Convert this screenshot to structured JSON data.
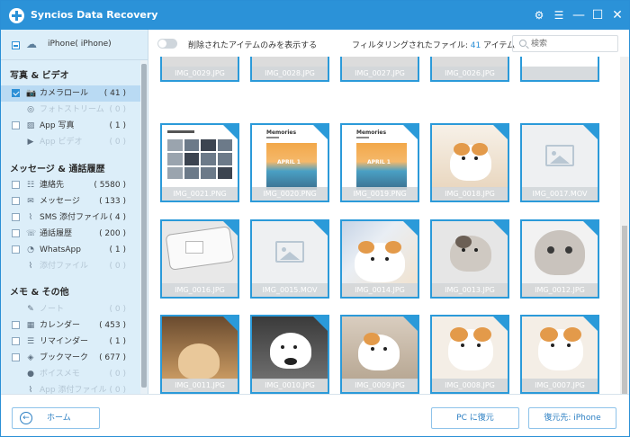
{
  "app": {
    "title": "Syncios Data Recovery"
  },
  "device": {
    "name": "iPhone( iPhone)"
  },
  "sidebar": {
    "photo_section": "写真 & ビデオ",
    "photo_items": [
      {
        "label": "カメラロール",
        "count": "( 41 )"
      },
      {
        "label": "フォトストリーム",
        "count": "( 0 )"
      },
      {
        "label": "App 写真",
        "count": "( 1 )"
      },
      {
        "label": "App ビデオ",
        "count": "( 0 )"
      }
    ],
    "message_section": "メッセージ & 通話履歴",
    "message_items": [
      {
        "label": "連絡先",
        "count": "( 5580 )"
      },
      {
        "label": "メッセージ",
        "count": "( 133 )"
      },
      {
        "label": "SMS 添付ファイル",
        "count": "( 4 )"
      },
      {
        "label": "通話履歴",
        "count": "( 200 )"
      },
      {
        "label": "WhatsApp",
        "count": "( 1 )"
      },
      {
        "label": "添付ファイル",
        "count": "( 0 )"
      }
    ],
    "memo_section": "メモ & その他",
    "memo_items": [
      {
        "label": "ノート",
        "count": "( 0 )"
      },
      {
        "label": "カレンダー",
        "count": "( 453 )"
      },
      {
        "label": "リマインダー",
        "count": "( 1 )"
      },
      {
        "label": "ブックマーク",
        "count": "( 677 )"
      },
      {
        "label": "ボイスメモ",
        "count": "( 0 )"
      },
      {
        "label": "App 添付ファイル",
        "count": "( 0 )"
      }
    ]
  },
  "toolbar": {
    "toggle_label": "削除されたアイテムのみを表示する",
    "filter_prefix": "フィルタリングされたファイル: ",
    "filter_count": "41",
    "filter_suffix": " アイテム",
    "search_placeholder": "検索"
  },
  "grid": {
    "row1": [
      "IMG_0029.JPG",
      "IMG_0028.JPG",
      "IMG_0027.JPG",
      "IMG_0026.JPG"
    ],
    "row2": [
      "IMG_0021.PNG",
      "IMG_0020.PNG",
      "IMG_0019.PNG",
      "IMG_0018.JPG",
      "IMG_0017.MOV"
    ],
    "row3": [
      "IMG_0016.JPG",
      "IMG_0015.MOV",
      "IMG_0014.JPG",
      "IMG_0013.JPG",
      "IMG_0012.JPG"
    ],
    "row4": [
      "IMG_0011.JPG",
      "IMG_0010.JPG",
      "IMG_0009.JPG",
      "IMG_0008.JPG",
      "IMG_0007.JPG"
    ],
    "memories_title": "Memories",
    "memories_sub": "APRIL 1"
  },
  "buttons": {
    "home": "ホーム",
    "restore_pc": "PC に復元",
    "restore_device": "復元先: iPhone"
  }
}
